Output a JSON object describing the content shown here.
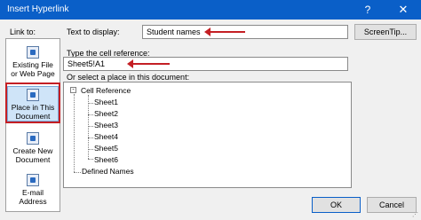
{
  "window": {
    "title": "Insert Hyperlink",
    "help_glyph": "?",
    "close_glyph": "✕"
  },
  "link_to": {
    "label": "Link to:",
    "items": [
      {
        "label_line1": "Existing File",
        "label_line2": "or Web Page"
      },
      {
        "label_line1": "Place in This",
        "label_line2": "Document"
      },
      {
        "label_line1": "Create New",
        "label_line2": "Document"
      },
      {
        "label_line1": "E-mail",
        "label_line2": "Address"
      }
    ]
  },
  "text_to_display": {
    "label": "Text to display:",
    "value": "Student names"
  },
  "screentip": {
    "label": "ScreenTip..."
  },
  "cell_reference": {
    "label": "Type the cell reference:",
    "value": "Sheet5!A1"
  },
  "place_select": {
    "label": "Or select a place in this document:",
    "tree": {
      "root": "Cell Reference",
      "sheets": [
        "Sheet1",
        "Sheet2",
        "Sheet3",
        "Sheet4",
        "Sheet5",
        "Sheet6"
      ],
      "defined_names": "Defined Names"
    }
  },
  "buttons": {
    "ok": "OK",
    "cancel": "Cancel"
  },
  "colors": {
    "titlebar": "#0a5fc8",
    "highlight": "#c41f24",
    "selected_bg": "#cfe4f8"
  }
}
